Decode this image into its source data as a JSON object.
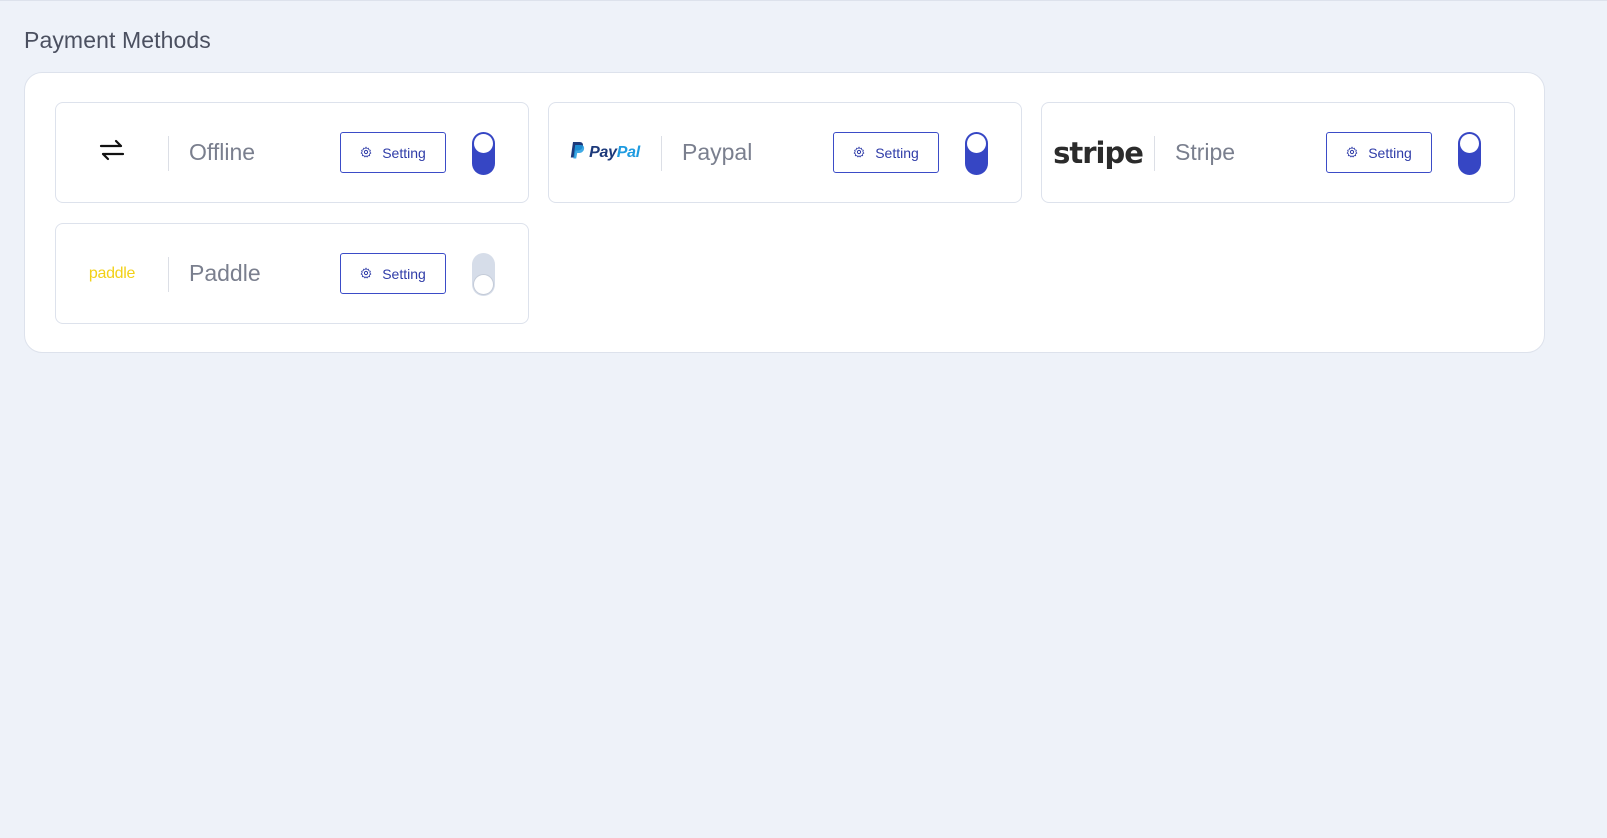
{
  "page": {
    "title": "Payment Methods"
  },
  "colors": {
    "accent": "#3646c4",
    "toggle_off": "#d6dde9",
    "paddle_brand": "#f2d118",
    "paypal_dark": "#1d3a7b",
    "paypal_light": "#1e9be0"
  },
  "methods": [
    {
      "name": "Offline",
      "logo_icon": "swap-arrows-icon",
      "setting_label": "Setting",
      "enabled": true
    },
    {
      "name": "Paypal",
      "logo_text_1": "Pay",
      "logo_text_2": "Pal",
      "logo_icon": "paypal-p-icon",
      "setting_label": "Setting",
      "enabled": true
    },
    {
      "name": "Stripe",
      "logo_text": "stripe",
      "setting_label": "Setting",
      "enabled": true
    },
    {
      "name": "Paddle",
      "logo_text": "paddle",
      "setting_label": "Setting",
      "enabled": false
    }
  ]
}
